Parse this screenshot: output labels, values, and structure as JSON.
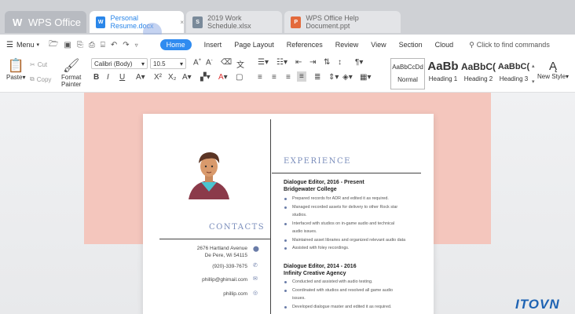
{
  "app": {
    "name": "WPS Office"
  },
  "tabs": [
    {
      "label": "Personal Resume.docx",
      "type": "W",
      "color": "#2a86e9",
      "active": true
    },
    {
      "label": "2019 Work Schedule.xlsx",
      "type": "S",
      "color": "#7a8a9a",
      "active": false
    },
    {
      "label": "WPS Office Help Document.ppt",
      "type": "P",
      "color": "#e36a3c",
      "active": false
    }
  ],
  "menu": {
    "menu_label": "Menu",
    "ribbon_tabs": [
      "Home",
      "Insert",
      "Page Layout",
      "References",
      "Review",
      "View",
      "Section",
      "Cloud"
    ],
    "find_placeholder": "Click to find commands"
  },
  "ribbon": {
    "paste": "Paste",
    "cut": "Cut",
    "copy": "Copy",
    "format_painter_1": "Format",
    "format_painter_2": "Painter",
    "font_name": "Calibri (Body)",
    "font_size": "10.5",
    "styles": [
      {
        "sample": "AaBbCcDd",
        "label": "Normal"
      },
      {
        "sample": "AaBb",
        "label": "Heading 1"
      },
      {
        "sample": "AaBbC(",
        "label": "Heading 2"
      },
      {
        "sample": "AaBbC(",
        "label": "Heading 3"
      }
    ],
    "new_style": "New Style"
  },
  "resume": {
    "contacts_title": "CONTACTS",
    "address_1": "2676 Hartland Avenue",
    "address_2": "De Pere, Wi 54115",
    "phone": "(920)-339-7675",
    "email": "phillip@ghimail.com",
    "website": "phillip.com",
    "experience_title": "EXPERIENCE",
    "jobs": [
      {
        "title": "Dialogue Editor, 2016 - Present",
        "company": "Bridgewater College",
        "bullets": [
          "Prepared records for ADR and edited it as required.",
          "Managed recorded assets for delivery to other Rock star",
          "studios.",
          "Interfaced with studios on in-game audio and technical",
          "audio issues.",
          "Maintained asset libraries and organized relevant audio data",
          "Assisted with foley recordings."
        ]
      },
      {
        "title": "Dialogue Editor, 2014 - 2016",
        "company": "Infinity Creative Agency",
        "bullets": [
          "Conducted and assisted with audio testing.",
          "Coordinated with studios and resolved all game audio",
          "issues.",
          "Developed dialogue master and edited it as required."
        ]
      }
    ]
  },
  "watermark": {
    "text_a": "ITO",
    "text_b": "VN"
  }
}
